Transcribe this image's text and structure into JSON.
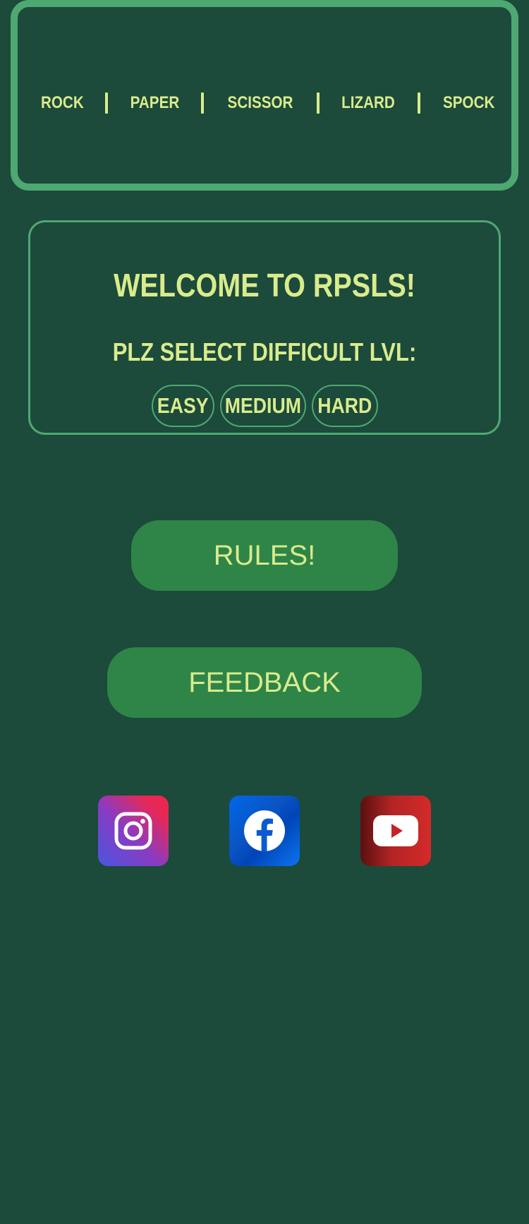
{
  "nav": {
    "items": [
      "ROCK",
      "PAPER",
      "SCISSOR",
      "LIZARD",
      "SPOCK"
    ]
  },
  "welcome": {
    "title": "WELCOME TO RPSLS!",
    "difficulty_prompt": "PLZ SELECT DIFFICULT LVL:",
    "levels": [
      "EASY",
      "MEDIUM",
      "HARD"
    ]
  },
  "buttons": {
    "rules": "RULES!",
    "feedback": "FEEDBACK"
  },
  "social": {
    "icons": [
      "instagram-icon",
      "facebook-icon",
      "youtube-icon"
    ]
  },
  "colors": {
    "background": "#1c4a3b",
    "accent_border": "#4ea871",
    "text": "#d9eb8c",
    "button": "#2e8547"
  }
}
